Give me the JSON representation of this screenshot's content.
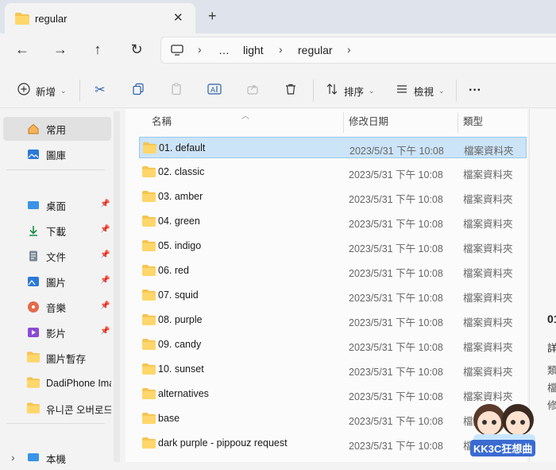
{
  "window": {
    "tab_title": "regular",
    "close_glyph": "✕",
    "new_tab_glyph": "+"
  },
  "nav": {
    "back": "←",
    "forward": "→",
    "up": "↑",
    "refresh": "↻",
    "breadcrumbs": [
      "…",
      "light",
      "regular"
    ],
    "chevron": "›"
  },
  "toolbar": {
    "new_label": "新增",
    "sort_label": "排序",
    "view_label": "檢視",
    "more": "···"
  },
  "sidebar": {
    "items": [
      {
        "label": "常用",
        "icon": "home-icon",
        "pinned": false
      },
      {
        "label": "圖庫",
        "icon": "gallery-icon",
        "pinned": false
      },
      {
        "label": "桌面",
        "icon": "desktop-icon",
        "pinned": true
      },
      {
        "label": "下載",
        "icon": "download-icon",
        "pinned": true
      },
      {
        "label": "文件",
        "icon": "document-icon",
        "pinned": true
      },
      {
        "label": "圖片",
        "icon": "pictures-icon",
        "pinned": true
      },
      {
        "label": "音樂",
        "icon": "music-icon",
        "pinned": true
      },
      {
        "label": "影片",
        "icon": "video-icon",
        "pinned": true
      },
      {
        "label": "圖片暫存",
        "icon": "folder-icon",
        "pinned": false
      },
      {
        "label": "DadiPhone Ima",
        "icon": "folder-icon",
        "pinned": false
      },
      {
        "label": "유니콘 오버로드",
        "icon": "folder-icon",
        "pinned": false
      },
      {
        "label": "本機",
        "icon": "pc-icon",
        "pinned": false
      }
    ]
  },
  "columns": {
    "name": "名稱",
    "date": "修改日期",
    "type": "類型"
  },
  "files": [
    {
      "name": "01. default",
      "date": "2023/5/31 下午 10:08",
      "type": "檔案資料夾"
    },
    {
      "name": "02. classic",
      "date": "2023/5/31 下午 10:08",
      "type": "檔案資料夾"
    },
    {
      "name": "03. amber",
      "date": "2023/5/31 下午 10:08",
      "type": "檔案資料夾"
    },
    {
      "name": "04. green",
      "date": "2023/5/31 下午 10:08",
      "type": "檔案資料夾"
    },
    {
      "name": "05. indigo",
      "date": "2023/5/31 下午 10:08",
      "type": "檔案資料夾"
    },
    {
      "name": "06. red",
      "date": "2023/5/31 下午 10:08",
      "type": "檔案資料夾"
    },
    {
      "name": "07. squid",
      "date": "2023/5/31 下午 10:08",
      "type": "檔案資料夾"
    },
    {
      "name": "08. purple",
      "date": "2023/5/31 下午 10:08",
      "type": "檔案資料夾"
    },
    {
      "name": "09. candy",
      "date": "2023/5/31 下午 10:08",
      "type": "檔案資料夾"
    },
    {
      "name": "10. sunset",
      "date": "2023/5/31 下午 10:08",
      "type": "檔案資料夾"
    },
    {
      "name": "alternatives",
      "date": "2023/5/31 下午 10:08",
      "type": "檔案資料夾"
    },
    {
      "name": "base",
      "date": "2023/5/31 下午 10:08",
      "type": "檔案資料夾"
    },
    {
      "name": "dark purple - pippouz request",
      "date": "2023/5/31 下午 10:08",
      "type": "檔案資料夾"
    }
  ],
  "preview": {
    "lines": [
      "01",
      "詳",
      "類",
      "檔",
      "修"
    ]
  },
  "watermark": {
    "text": "KK3C狂想曲"
  },
  "colors": {
    "selection_bg": "#cce4f7",
    "selection_border": "#99c9ef",
    "folder_yellow": "#f5c451"
  }
}
